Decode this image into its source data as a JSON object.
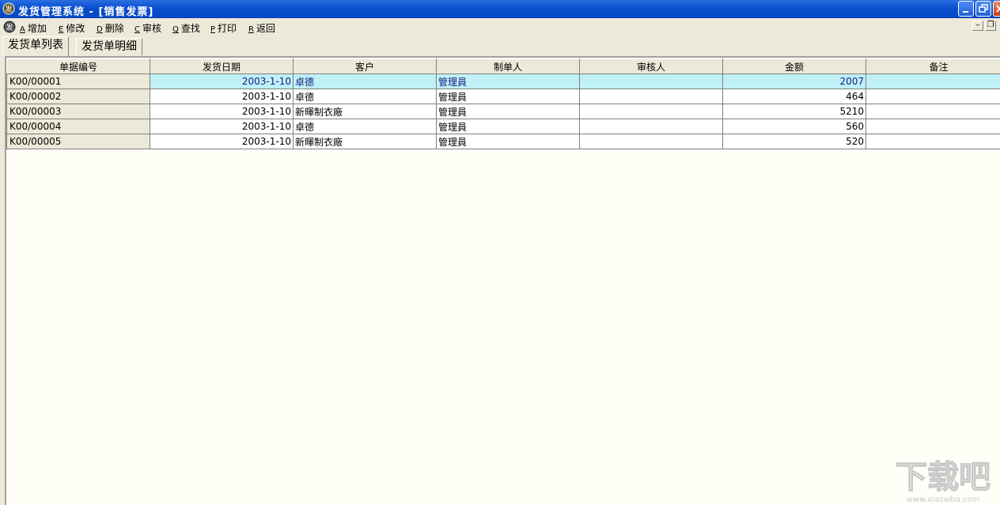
{
  "window": {
    "title": "发货管理系统 - [销售发票]"
  },
  "menu": {
    "items": [
      {
        "key": "A",
        "label": "增加"
      },
      {
        "key": "E",
        "label": "修改"
      },
      {
        "key": "D",
        "label": "删除"
      },
      {
        "key": "C",
        "label": "审核"
      },
      {
        "key": "Q",
        "label": "查找"
      },
      {
        "key": "P",
        "label": "打印"
      },
      {
        "key": "R",
        "label": "返回"
      }
    ],
    "mdi_min": "–",
    "mdi_restore": "❐"
  },
  "tabs": [
    {
      "label": "发货单列表",
      "active": true
    },
    {
      "label": "发货单明细",
      "active": false
    }
  ],
  "grid": {
    "columns": [
      "单据编号",
      "发货日期",
      "客户",
      "制单人",
      "审核人",
      "金额",
      "备注"
    ],
    "rows": [
      {
        "id": "K00/00001",
        "date": "2003-1-10",
        "customer": "卓德",
        "maker": "管理員",
        "auditor": "",
        "amount": "2007",
        "note": "",
        "selected": true
      },
      {
        "id": "K00/00002",
        "date": "2003-1-10",
        "customer": "卓德",
        "maker": "管理員",
        "auditor": "",
        "amount": "464",
        "note": ""
      },
      {
        "id": "K00/00003",
        "date": "2003-1-10",
        "customer": "新暉制衣廠",
        "maker": "管理員",
        "auditor": "",
        "amount": "5210",
        "note": ""
      },
      {
        "id": "K00/00004",
        "date": "2003-1-10",
        "customer": "卓德",
        "maker": "管理員",
        "auditor": "",
        "amount": "560",
        "note": ""
      },
      {
        "id": "K00/00005",
        "date": "2003-1-10",
        "customer": "新暉制衣廠",
        "maker": "管理員",
        "auditor": "",
        "amount": "520",
        "note": ""
      }
    ]
  },
  "colors": {
    "titlebar": "#0a4fcf",
    "selected_row": "#bff0f6",
    "selected_text": "#1a1a80",
    "face": "#ece9d8",
    "workspace": "#fffff8"
  },
  "watermark": {
    "main": "下载吧",
    "url": "www.xiazaiba.com"
  }
}
